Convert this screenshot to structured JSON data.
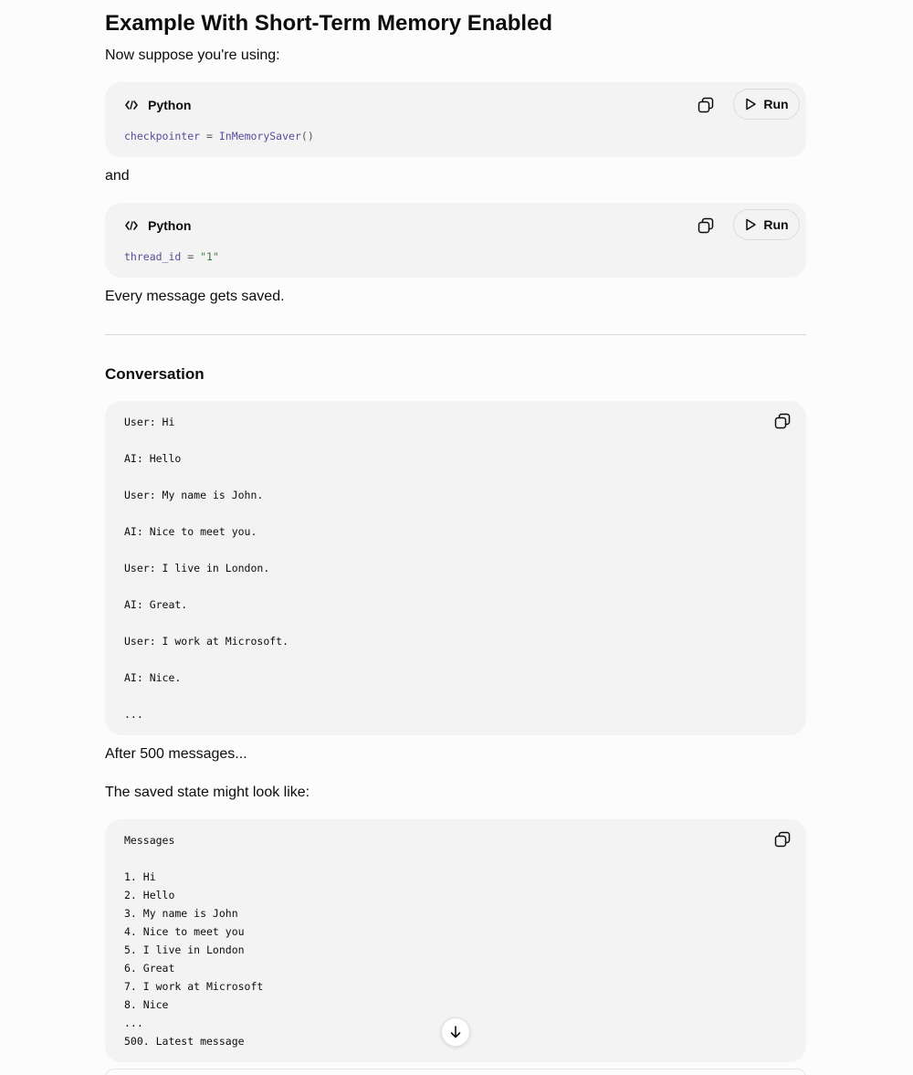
{
  "article": {
    "title": "Example With Short-Term Memory Enabled",
    "intro": "Now suppose you're using:",
    "and_text": "and",
    "saved_text": "Every message gets saved.",
    "conversation_heading": "Conversation",
    "after_text": "After 500 messages...",
    "state_text": "The saved state might look like:"
  },
  "code_blocks": [
    {
      "language": "Python",
      "run_label": "Run",
      "tokens": [
        "checkpointer",
        " = ",
        "InMemorySaver",
        "()"
      ]
    },
    {
      "language": "Python",
      "run_label": "Run",
      "tokens": [
        "thread_id",
        " = ",
        "\"1\""
      ]
    }
  ],
  "conversation_block": {
    "lines": [
      "User: Hi",
      "",
      "AI: Hello",
      "",
      "User: My name is John.",
      "",
      "AI: Nice to meet you.",
      "",
      "User: I live in London.",
      "",
      "AI: Great.",
      "",
      "User: I work at Microsoft.",
      "",
      "AI: Nice.",
      "",
      "..."
    ]
  },
  "state_block": {
    "lines": [
      "Messages",
      "",
      "1. Hi",
      "2. Hello",
      "3. My name is John",
      "4. Nice to meet you",
      "5. I live in London",
      "6. Great",
      "7. I work at Microsoft",
      "8. Nice",
      "...",
      "500. Latest message"
    ]
  },
  "icons": {
    "code": "code-brackets-icon",
    "copy": "copy-icon",
    "run": "play-icon",
    "scroll": "arrow-down-icon"
  }
}
